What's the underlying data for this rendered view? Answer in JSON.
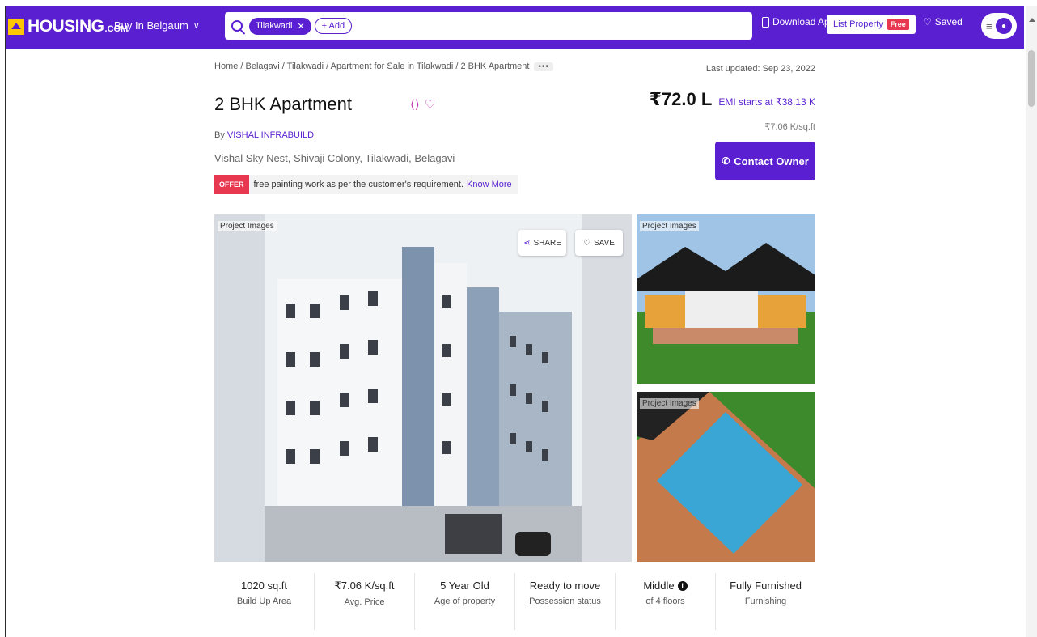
{
  "brand": {
    "name": "HOUSING",
    "suffix": ".COM"
  },
  "navbar": {
    "city_label": "Buy In Belgaum",
    "search_chip": "Tilakwadi",
    "add_label": "+ Add",
    "download_label": "Download App",
    "list_property_label": "List Property",
    "free_label": "Free",
    "saved_label": "Saved"
  },
  "breadcrumb": {
    "text": "Home / Belagavi / Tilakwadi / Apartment for Sale in Tilakwadi / 2 BHK Apartment",
    "more": "•••"
  },
  "last_updated": "Last updated: Sep 23, 2022",
  "listing": {
    "title": "2 BHK Apartment",
    "by_prefix": "By",
    "builder": "VISHAL INFRABUILD",
    "address": "Vishal Sky Nest, Shivaji Colony, Tilakwadi, Belagavi",
    "price": "₹72.0 L",
    "emi": "EMI starts at ₹38.13 K",
    "price_per_sqft": "₹7.06 K/sq.ft",
    "contact_label": "Contact Owner"
  },
  "offer": {
    "badge": "OFFER",
    "text": "free painting work as per the customer's requirement.",
    "link": "Know More"
  },
  "gallery": {
    "main_label": "Project Images",
    "side1_label": "Project Images",
    "side2_label": "Project Images",
    "share_label": "SHARE",
    "save_label": "SAVE"
  },
  "stats": [
    {
      "value": "1020 sq.ft",
      "label": "Build Up Area"
    },
    {
      "value": "₹7.06 K/sq.ft",
      "label": "Avg. Price"
    },
    {
      "value": "5 Year Old",
      "label": "Age of property"
    },
    {
      "value": "Ready to move",
      "label": "Possession status"
    },
    {
      "value": "Middle",
      "label": "of 4 floors"
    },
    {
      "value": "Fully Furnished",
      "label": "Furnishing"
    }
  ],
  "colors": {
    "brand": "#5a1fd1",
    "logo": "#ffc700",
    "offer": "#e8384f"
  }
}
